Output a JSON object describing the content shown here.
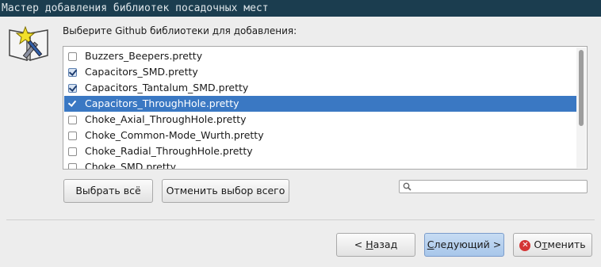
{
  "window": {
    "title": "Мастер добавления библиотек посадочных мест"
  },
  "prompt": "Выберите Github библиотеки для добавления:",
  "libraries": [
    {
      "name": "Buzzers_Beepers.pretty",
      "checked": false,
      "selected": false
    },
    {
      "name": "Capacitors_SMD.pretty",
      "checked": true,
      "selected": false
    },
    {
      "name": "Capacitors_Tantalum_SMD.pretty",
      "checked": true,
      "selected": false
    },
    {
      "name": "Capacitors_ThroughHole.pretty",
      "checked": true,
      "selected": true
    },
    {
      "name": "Choke_Axial_ThroughHole.pretty",
      "checked": false,
      "selected": false
    },
    {
      "name": "Choke_Common-Mode_Wurth.pretty",
      "checked": false,
      "selected": false
    },
    {
      "name": "Choke_Radial_ThroughHole.pretty",
      "checked": false,
      "selected": false
    },
    {
      "name": "Choke_SMD.pretty",
      "checked": false,
      "selected": false
    }
  ],
  "buttons": {
    "select_all": "Выбрать всё",
    "deselect_all": "Отменить выбор всего",
    "back_prefix": "< ",
    "back_mnemonic": "Н",
    "back_rest": "азад",
    "next_mnemonic": "С",
    "next_rest": "ледующий >",
    "cancel_pre": "О",
    "cancel_mnemonic": "т",
    "cancel_rest": "менить"
  },
  "search": {
    "value": "",
    "placeholder": ""
  },
  "colors": {
    "titlebar": "#1b3d4f",
    "selection": "#3a78c3",
    "primary_button": "#b6d0ee",
    "cancel_icon": "#d43535"
  },
  "icons": {
    "wizard": "book-star-wrench-icon",
    "search": "search-icon",
    "cancel": "cancel-icon"
  }
}
